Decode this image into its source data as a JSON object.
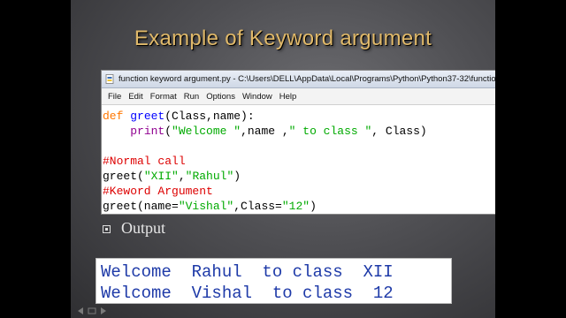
{
  "slide": {
    "title": "Example of Keyword argument",
    "bullet": "Output"
  },
  "editor": {
    "window_title": "function keyword argument.py - C:\\Users\\DELL\\AppData\\Local\\Programs\\Python\\Python37-32\\function",
    "menu": [
      "File",
      "Edit",
      "Format",
      "Run",
      "Options",
      "Window",
      "Help"
    ],
    "code": {
      "line1": {
        "kw": "def",
        "fn": "greet",
        "rest": "(Class,name):"
      },
      "line2": {
        "indent": "    ",
        "bi": "print",
        "p1": "(",
        "s1": "\"Welcome \"",
        "p2": ",name ,",
        "s2": "\" to class \"",
        "p3": ", Class)"
      },
      "line4": {
        "cm": "#Normal call"
      },
      "line5": {
        "p1": "greet(",
        "s1": "\"XII\"",
        "p2": ",",
        "s2": "\"Rahul\"",
        "p3": ")"
      },
      "line6": {
        "cm": "#Keword Argument"
      },
      "line7": {
        "p1": "greet(name=",
        "s1": "\"Vishal\"",
        "p2": ",Class=",
        "s2": "\"12\"",
        "p3": ")"
      }
    }
  },
  "output": {
    "line1": "Welcome  Rahul  to class  XII",
    "line2": "Welcome  Vishal  to class  12"
  },
  "colors": {
    "title": "#e0b96a",
    "keyword": "#ff7700",
    "function_name": "#0000ff",
    "string": "#00aa00",
    "comment": "#dd0000",
    "builtin": "#900090",
    "output_text": "#1e3aa8"
  }
}
